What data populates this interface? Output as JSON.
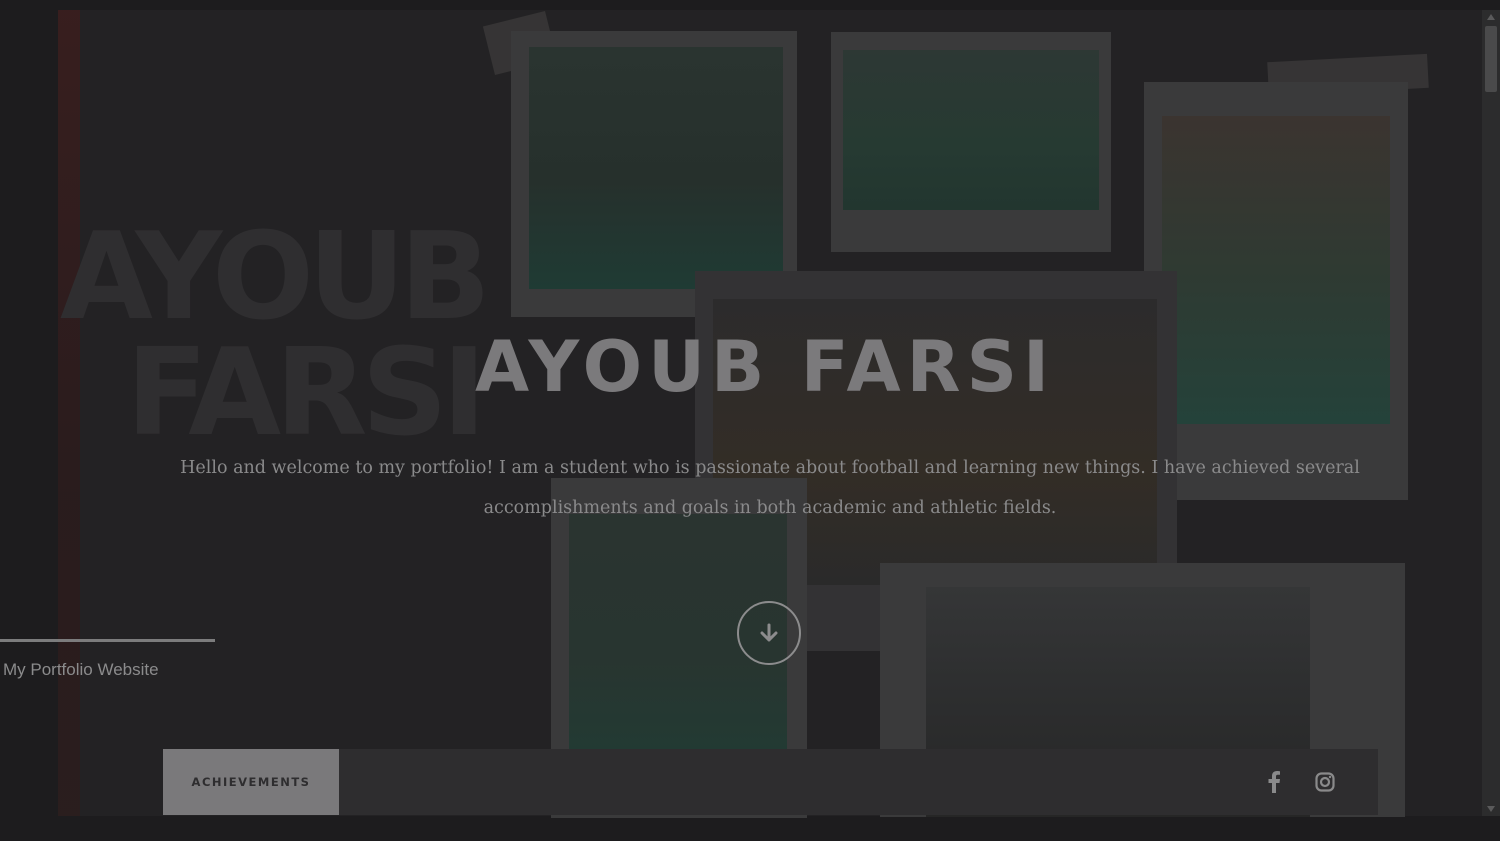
{
  "hero": {
    "background_name_line1": "AYOUB",
    "background_name_line2": "FARSI",
    "title": "AYOUB FARSI",
    "intro": "Hello and welcome to my portfolio! I am a student who is passionate about football and learning new things. I have achieved several accomplishments and goals in both academic and athletic fields."
  },
  "sidebar": {
    "site_label": "My Portfolio Website"
  },
  "nav": {
    "achievements_label": "ACHIEVEMENTS",
    "social_icons": [
      "facebook-icon",
      "instagram-icon"
    ]
  },
  "icons": {
    "scroll_down": "arrow-down-icon"
  },
  "colors": {
    "overlay": "#1d1c1e",
    "title": "#7b7a7c",
    "text": "#8a8a8b",
    "nav_bar": "#2e2d2f",
    "nav_button": "#7a797b"
  }
}
